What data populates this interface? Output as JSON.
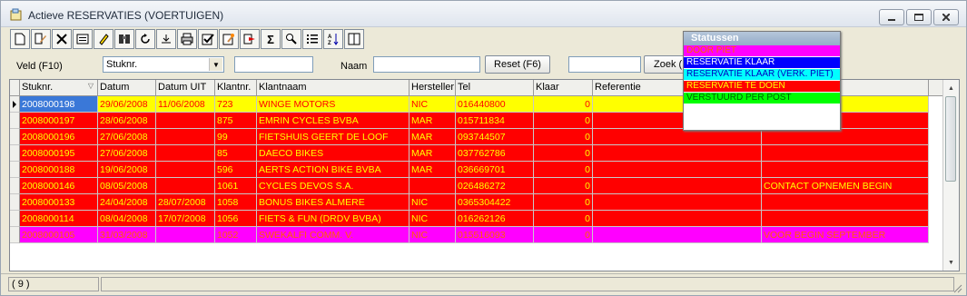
{
  "window": {
    "title": "Actieve RESERVATIES (VOERTUIGEN)"
  },
  "toolbar": {
    "icons": [
      "new-doc-icon",
      "edit-doc-icon",
      "delete-icon",
      "properties-icon",
      "highlighter-icon",
      "binoculars-icon",
      "refresh-icon",
      "export-icon",
      "print-icon",
      "check-icon",
      "edit-form-icon",
      "forward-icon",
      "sigma-icon",
      "find-icon",
      "list-view-icon",
      "sort-az-icon",
      "columns-icon"
    ],
    "sigma": "Σ"
  },
  "filter": {
    "veld_label": "Veld (F10)",
    "veld_value": "Stuknr.",
    "veld_input": "",
    "naam_label": "Naam",
    "naam_value": "",
    "reset_label": "Reset (F6)",
    "zoek_input": "",
    "zoek_label": "Zoek (F"
  },
  "table": {
    "columns": [
      "Stuknr.",
      "Datum",
      "Datum UIT",
      "Klantnr.",
      "Klantnaam",
      "Hersteller",
      "Tel",
      "Klaar",
      "Referentie",
      ""
    ],
    "rows": [
      {
        "stuknr": "2008000198",
        "datum": "29/06/2008",
        "datum_uit": "11/06/2008",
        "klantnr": "723",
        "klantnaam": "WINGE MOTORS",
        "hersteller": "NIC",
        "tel": "016440800",
        "klaar": "0",
        "referentie": "",
        "opmerking": "",
        "status": "selected"
      },
      {
        "stuknr": "2008000197",
        "datum": "28/06/2008",
        "datum_uit": "",
        "klantnr": "875",
        "klantnaam": "EMRIN CYCLES BVBA",
        "hersteller": "MAR",
        "tel": "015711834",
        "klaar": "0",
        "referentie": "",
        "opmerking": "",
        "status": "te_doen"
      },
      {
        "stuknr": "2008000196",
        "datum": "27/06/2008",
        "datum_uit": "",
        "klantnr": "99",
        "klantnaam": "FIETSHUIS GEERT DE LOOF",
        "hersteller": "MAR",
        "tel": "093744507",
        "klaar": "0",
        "referentie": "",
        "opmerking": "",
        "status": "te_doen"
      },
      {
        "stuknr": "2008000195",
        "datum": "27/06/2008",
        "datum_uit": "",
        "klantnr": "85",
        "klantnaam": "DAECO BIKES",
        "hersteller": "MAR",
        "tel": "037762786",
        "klaar": "0",
        "referentie": "",
        "opmerking": "",
        "status": "te_doen"
      },
      {
        "stuknr": "2008000188",
        "datum": "19/06/2008",
        "datum_uit": "",
        "klantnr": "596",
        "klantnaam": "AERTS ACTION BIKE BVBA",
        "hersteller": "MAR",
        "tel": "036669701",
        "klaar": "0",
        "referentie": "",
        "opmerking": "",
        "status": "te_doen"
      },
      {
        "stuknr": "2008000146",
        "datum": "08/05/2008",
        "datum_uit": "",
        "klantnr": "1061",
        "klantnaam": "CYCLES DEVOS S.A.",
        "hersteller": "",
        "tel": "026486272",
        "klaar": "0",
        "referentie": "",
        "opmerking": "CONTACT OPNEMEN BEGIN",
        "status": "te_doen"
      },
      {
        "stuknr": "2008000133",
        "datum": "24/04/2008",
        "datum_uit": "28/07/2008",
        "klantnr": "1058",
        "klantnaam": "BONUS BIKES ALMERE",
        "hersteller": "NIC",
        "tel": "0365304422",
        "klaar": "0",
        "referentie": "",
        "opmerking": "",
        "status": "te_doen"
      },
      {
        "stuknr": "2008000114",
        "datum": "08/04/2008",
        "datum_uit": "17/07/2008",
        "klantnr": "1056",
        "klantnaam": "FIETS & FUN (DRDV BVBA)",
        "hersteller": "NIC",
        "tel": "016262126",
        "klaar": "0",
        "referentie": "",
        "opmerking": "",
        "status": "te_doen"
      },
      {
        "stuknr": "2008000105",
        "datum": "31/03/2008",
        "datum_uit": "",
        "klantnr": "1052",
        "klantnaam": "SWEKALFI COMM. V.",
        "hersteller": "NIC",
        "tel": "015516093",
        "klaar": "0",
        "referentie": "",
        "opmerking": "VOOR BEGIN SEPTEMBER",
        "status": "door_piet"
      }
    ]
  },
  "statussen": {
    "title": "Statussen",
    "items": [
      {
        "label": "DOOR PIET",
        "bg": "#ff00ff",
        "fg": "#ff6000"
      },
      {
        "label": "RESERVATIE KLAAR",
        "bg": "#0000ff",
        "fg": "#ffffff"
      },
      {
        "label": "RESERVATIE KLAAR (VERK. PIET)",
        "bg": "#00ffff",
        "fg": "#0000c0"
      },
      {
        "label": "RESERVATIE TE DOEN",
        "bg": "#ff0000",
        "fg": "#ffff00"
      },
      {
        "label": "VERSTUURD PER POST",
        "bg": "#00ff00",
        "fg": "#006000"
      }
    ]
  },
  "colors": {
    "selected_bg": "#ffff00",
    "selected_fg": "#ff0000",
    "te_doen_bg": "#ff0000",
    "te_doen_fg": "#ffff00",
    "door_piet_bg": "#ff00ff",
    "door_piet_fg": "#ff6000",
    "focus_bg": "#3a78d8",
    "focus_fg": "#ffffff"
  },
  "statusbar": {
    "count": "( 9 )"
  }
}
